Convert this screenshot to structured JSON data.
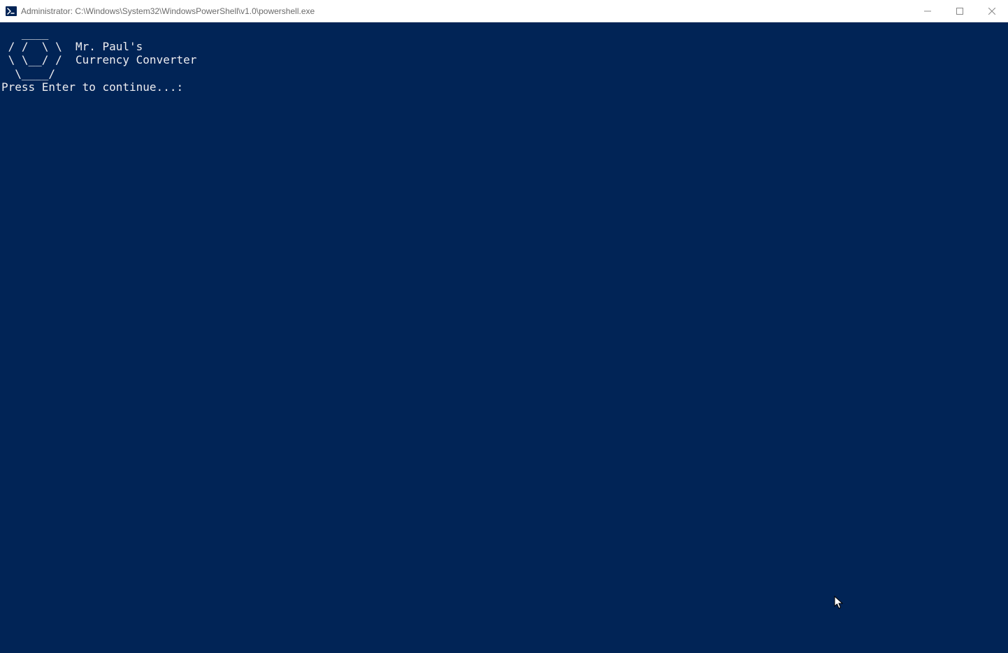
{
  "window": {
    "title": "Administrator: C:\\Windows\\System32\\WindowsPowerShell\\v1.0\\powershell.exe"
  },
  "terminal": {
    "ascii_art": [
      "   ____",
      "  /    \\   Mr. Paul's",
      " /  /\\  \\  ",
      " \\  \\/  /  Currency Converter",
      "  \\____/",
      ""
    ],
    "ascii_lines": {
      "l1": "   ____",
      "l2": " / /  \\ \\  Mr. Paul's",
      "l3": "/ /    \\ \\ ",
      "l4": "\\ \\    / / Currency Converter",
      "l5": " \\ \\__/ /",
      "l6": ""
    },
    "header_line1": "Mr. Paul's",
    "header_line2": "Currency Converter",
    "prompt": "Press Enter to continue...:"
  }
}
